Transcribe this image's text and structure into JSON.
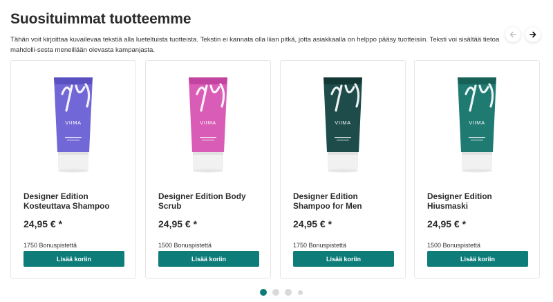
{
  "section": {
    "title": "Suosituimmat tuotteemme",
    "description": "Tähän voit kirjoittaa kuvailevaa tekstiä alla lueteltuista tuotteista. Tekstin ei kannata olla liian pitkä, jotta asiakkaalla on helppo pääsy tuotteisiin. Teksti voi sisältää tietoa mahdolli-sesta meneillään olevasta kampanjasta."
  },
  "nav": {
    "prev_icon": "arrow-left-icon",
    "next_icon": "arrow-right-icon"
  },
  "products": [
    {
      "name": "Designer Edition Kosteuttava Shampoo",
      "price": "24,95 € *",
      "points": "1750 Bonuspistettä",
      "button": "Lisää koriin",
      "brand": "VIIMA",
      "tube_color": "#7167d6",
      "tube_dark": "#5a50c2"
    },
    {
      "name": "Designer Edition Body Scrub",
      "price": "24,95 € *",
      "points": "1500 Bonuspistettä",
      "button": "Lisää koriin",
      "brand": "VIIMA",
      "tube_color": "#d95cb6",
      "tube_dark": "#c243a0"
    },
    {
      "name": "Designer Edition Shampoo for Men",
      "price": "24,95 € *",
      "points": "1750 Bonuspistettä",
      "button": "Lisää koriin",
      "brand": "VIIMA",
      "tube_color": "#1d4c4a",
      "tube_dark": "#143836"
    },
    {
      "name": "Designer Edition Hiusmaski",
      "price": "24,95 € *",
      "points": "1500 Bonuspistettä",
      "button": "Lisää koriin",
      "brand": "VIIMA",
      "tube_color": "#1f7a72",
      "tube_dark": "#176158"
    }
  ],
  "pagination": {
    "count": 4,
    "active": 0
  },
  "colors": {
    "accent": "#0e7d7a",
    "dot_inactive": "#d9d9d9"
  }
}
